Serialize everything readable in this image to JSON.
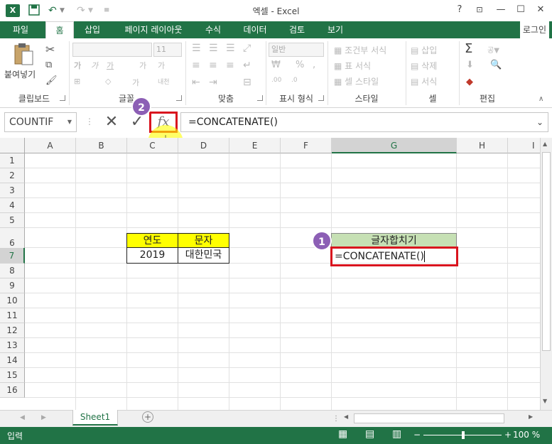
{
  "window": {
    "title": "엑셀 - Excel",
    "logo": "X",
    "help": "?",
    "ribbon_display": "⊡",
    "minimize": "—",
    "maximize": "☐",
    "close": "✕"
  },
  "tabs": [
    {
      "label": "파일"
    },
    {
      "label": "홈"
    },
    {
      "label": "삽입"
    },
    {
      "label": "페이지 레이아웃"
    },
    {
      "label": "수식"
    },
    {
      "label": "데이터"
    },
    {
      "label": "검토"
    },
    {
      "label": "보기"
    }
  ],
  "login": "로그인",
  "ribbon": {
    "clipboard": {
      "paste": "붙여넣기",
      "label": "클립보드"
    },
    "font": {
      "size": "11",
      "bold": "가",
      "italic": "가",
      "underline": "가",
      "grow": "가",
      "shrink": "가",
      "phonetic": "내천",
      "label": "글꼴"
    },
    "alignment": {
      "label": "맞춤"
    },
    "number": {
      "format": "일반",
      "percent": "%",
      "label": "표시 형식"
    },
    "styles": {
      "conditional": "조건부 서식",
      "table": "표 서식",
      "cell": "셀 스타일",
      "label": "스타일"
    },
    "cells": {
      "insert": "삽입",
      "delete": "삭제",
      "format": "서식",
      "label": "셀"
    },
    "editing": {
      "sum": "Σ",
      "sort": "공▼",
      "label": "편집"
    }
  },
  "formula_bar": {
    "name_box": "COUNTIF",
    "cancel": "✕",
    "enter": "✓",
    "fx": "fx",
    "formula": "=CONCATENATE()"
  },
  "columns": [
    "A",
    "B",
    "C",
    "D",
    "E",
    "F",
    "G",
    "H",
    "I"
  ],
  "rows": [
    "1",
    "2",
    "3",
    "4",
    "5",
    "6",
    "7",
    "8",
    "9",
    "10",
    "11",
    "12",
    "13",
    "14",
    "15",
    "16"
  ],
  "cells": {
    "C6": "연도",
    "D6": "문자",
    "C7": "2019",
    "D7": "대한민국",
    "G6": "글자합치기",
    "G7": "=CONCATENATE()"
  },
  "annotations": {
    "step1": "1",
    "step2": "2"
  },
  "sheet_tabs": [
    {
      "label": "Sheet1"
    }
  ],
  "status": {
    "mode": "입력",
    "zoom": "100 %"
  },
  "colors": {
    "accent": "#217346",
    "highlight_yellow": "#ffff00",
    "header_green": "#c6e0b4",
    "callout_red": "#d9141e",
    "badge_purple": "#8c5fb5"
  }
}
